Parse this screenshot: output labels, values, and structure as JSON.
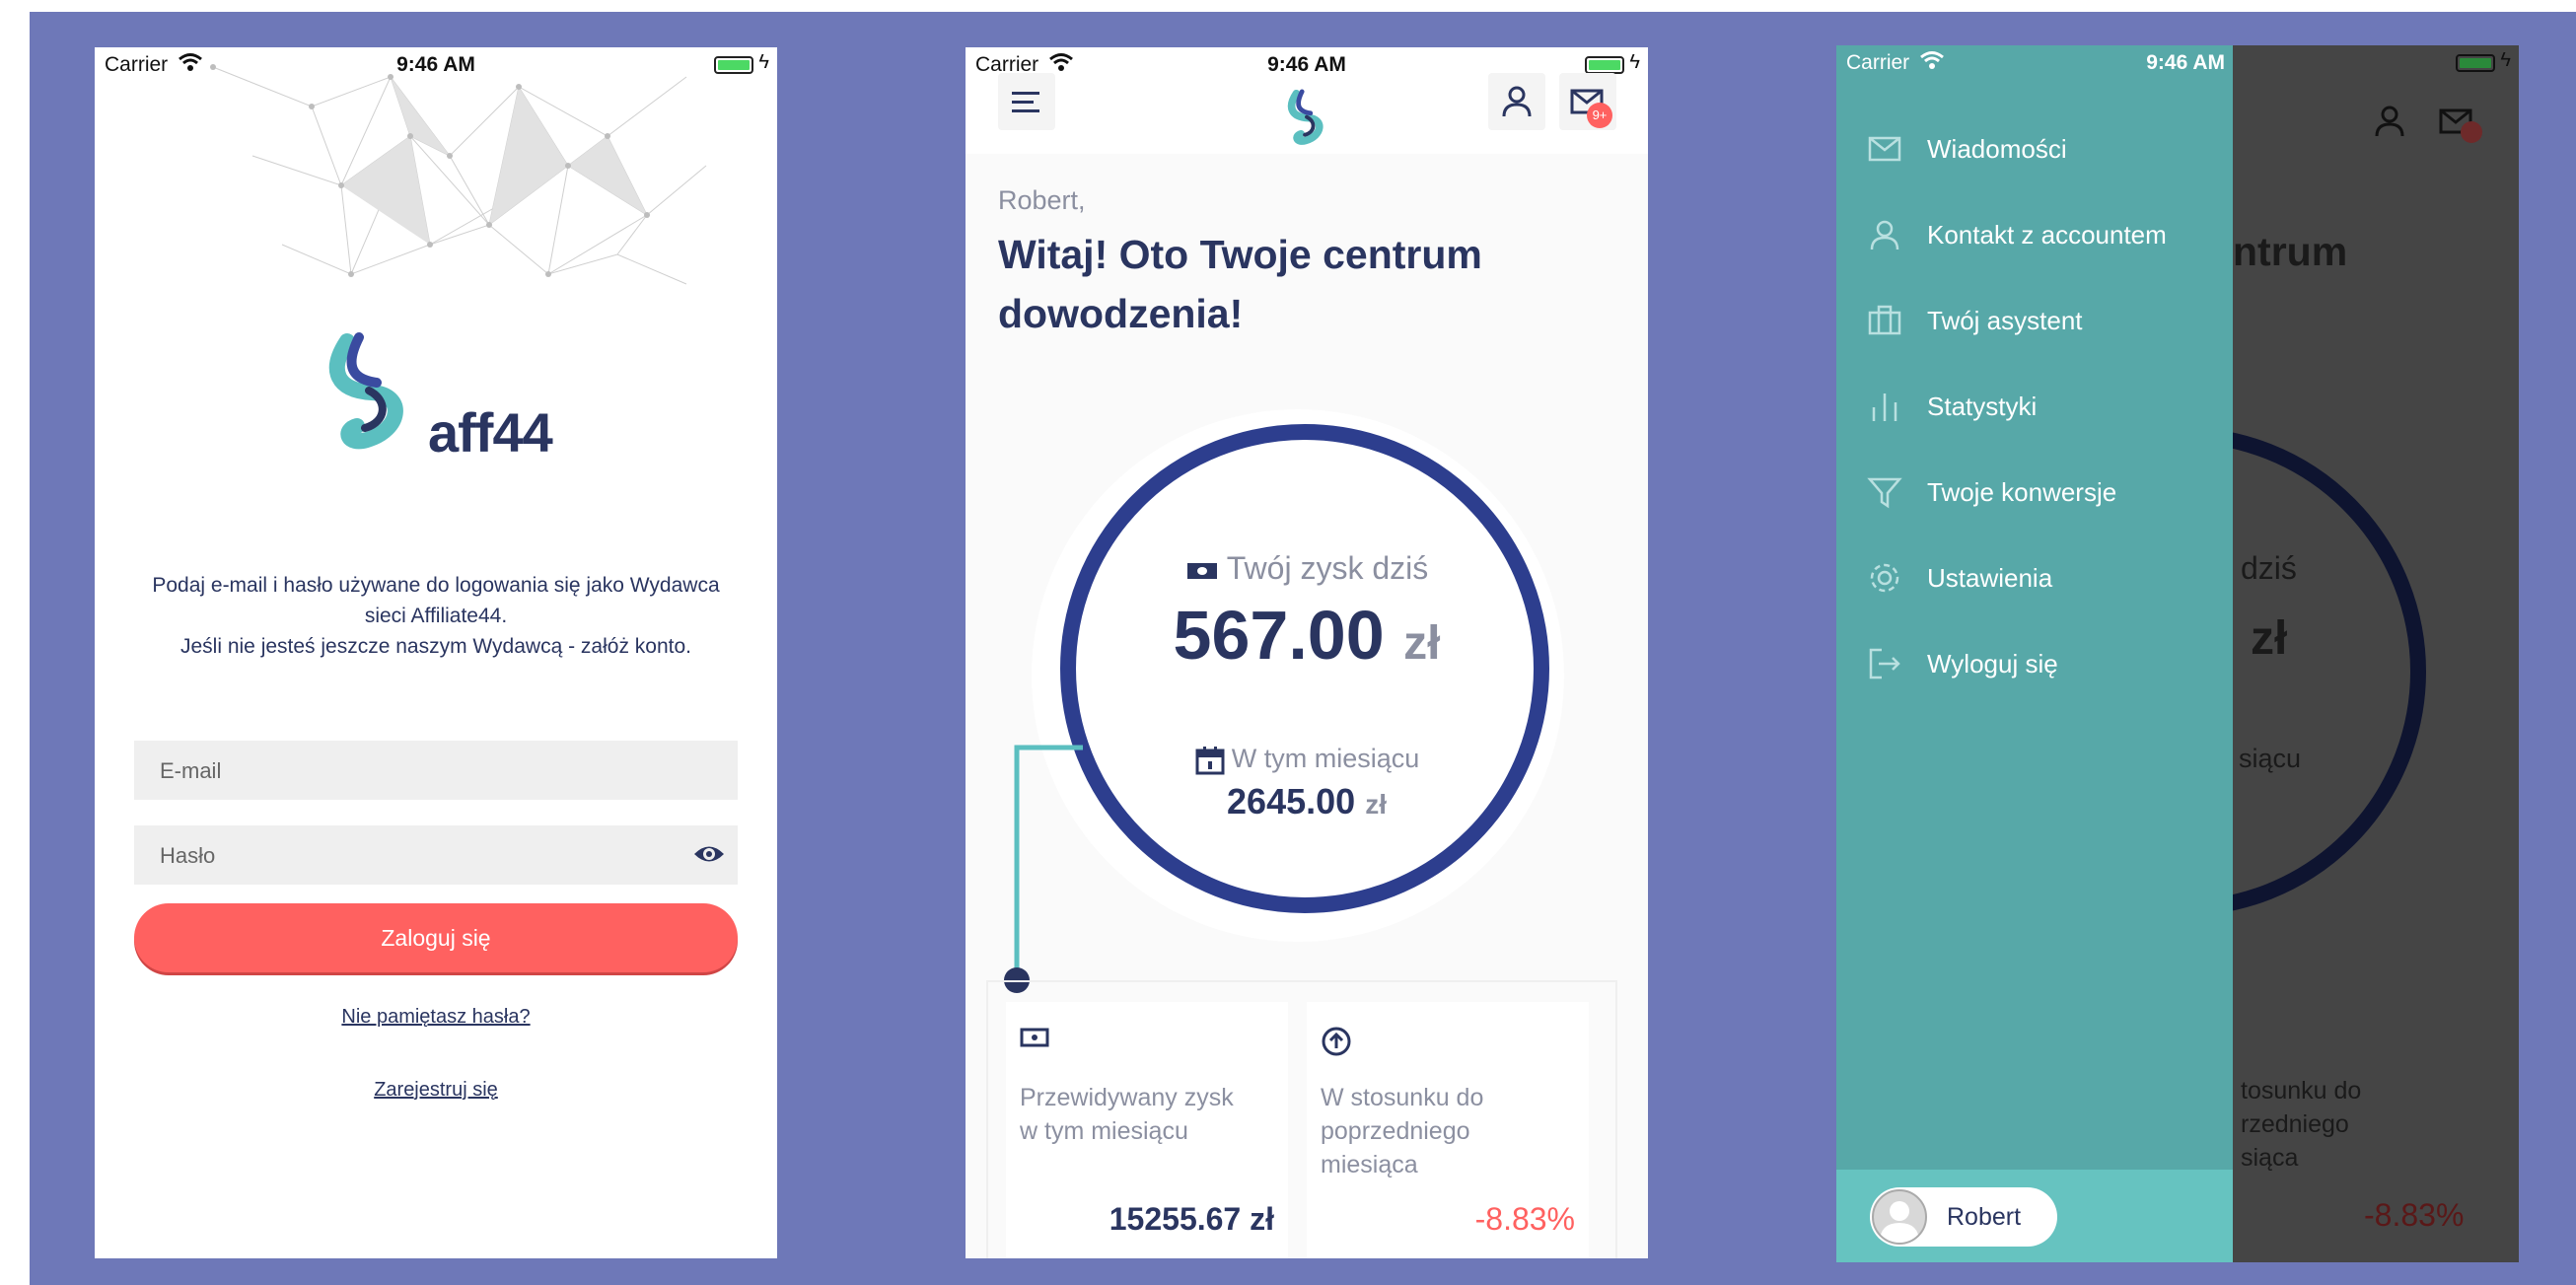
{
  "status": {
    "carrier": "Carrier",
    "time": "9:46 AM"
  },
  "login": {
    "brand": "aff44",
    "intro_line1": "Podaj e-mail i hasło używane do logowania się jako Wydawca",
    "intro_line2": "sieci Affiliate44.",
    "intro_line3": "Jeśli nie jesteś jeszcze naszym Wydawcą - załóż konto.",
    "email_placeholder": "E-mail",
    "password_placeholder": "Hasło",
    "login_button": "Zaloguj się",
    "forgot_link": "Nie pamiętasz hasła?",
    "register_link": "Zarejestruj się"
  },
  "dashboard": {
    "mail_badge": "9+",
    "greeting_name": "Robert,",
    "greeting_title": "Witaj! Oto Twoje centrum dowodzenia!",
    "today_label": "Twój zysk dziś",
    "today_value": "567.00",
    "currency": "zł",
    "month_label": "W tym miesiącu",
    "month_value": "2645.00",
    "card1_label": "Przewidywany zysk w tym miesiącu",
    "card1_value": "15255.67 zł",
    "card2_label": "W stosunku do poprzedniego miesiąca",
    "card2_value": "-8.83%"
  },
  "drawer": {
    "items": [
      {
        "label": "Wiadomości",
        "icon": "mail-icon"
      },
      {
        "label": "Kontakt z accountem",
        "icon": "user-icon"
      },
      {
        "label": "Twój asystent",
        "icon": "briefcase-icon"
      },
      {
        "label": "Statystyki",
        "icon": "bar-chart-icon"
      },
      {
        "label": "Twoje konwersje",
        "icon": "filter-icon"
      },
      {
        "label": "Ustawienia",
        "icon": "gear-icon"
      },
      {
        "label": "Wyloguj się",
        "icon": "logout-icon"
      }
    ],
    "user_name": "Robert",
    "dim_title": "ntrum",
    "dim_today": "dziś",
    "dim_value": "zł",
    "dim_month": "siącu",
    "dim_card2a": "tosunku do",
    "dim_card2b": "rzedniego",
    "dim_card2c": "siąca",
    "dim_card2_value": "-8.83%"
  },
  "colors": {
    "background": "#6e78b8",
    "navy": "#2a3560",
    "ring": "#2d3e8e",
    "coral": "#ff6160",
    "teal_drawer": "#57a8a8",
    "teal_footer": "#66c3c0"
  }
}
